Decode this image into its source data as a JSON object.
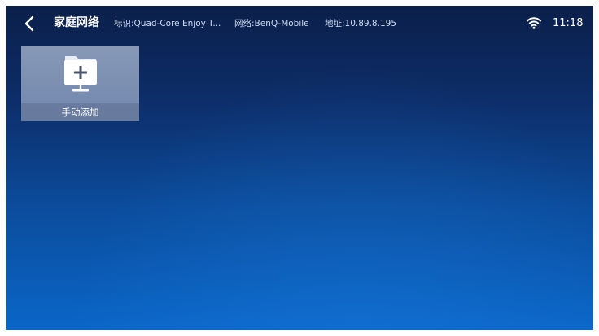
{
  "header": {
    "back_icon": "chevron-left-icon",
    "title": "家庭网络",
    "identifier": "标识:Quad-Core Enjoy T...",
    "network": "网络:BenQ-Mobile",
    "address": "地址:10.89.8.195"
  },
  "status": {
    "wifi_icon": "wifi-icon",
    "time": "11:18"
  },
  "tiles": [
    {
      "icon": "add-folder-icon",
      "label": "手动添加"
    }
  ],
  "colors": {
    "background_top": "#0b1f4a",
    "background_bottom": "#0a66c8",
    "tile_bg": "#a9b8d2",
    "text": "#ffffff"
  }
}
